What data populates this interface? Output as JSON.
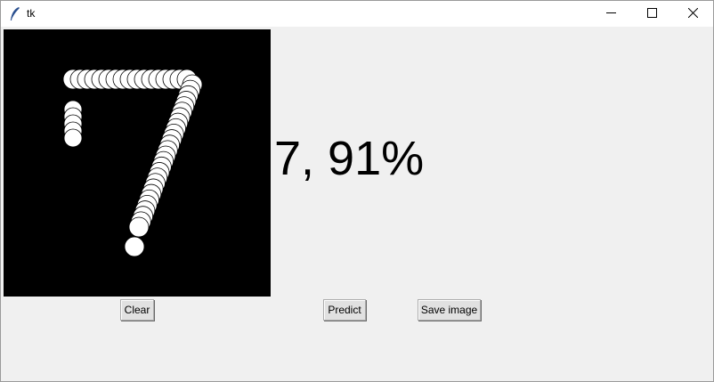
{
  "window": {
    "title": "tk",
    "controls": {
      "minimize_icon": "minimize-icon",
      "maximize_icon": "maximize-icon",
      "close_icon": "close-icon"
    }
  },
  "canvas": {
    "background": "#000000",
    "stroke_color": "#ffffff",
    "drawn_digit": "7"
  },
  "prediction": {
    "text": "7, 91%"
  },
  "buttons": {
    "clear_label": "Clear",
    "predict_label": "Predict",
    "save_label": "Save image"
  }
}
